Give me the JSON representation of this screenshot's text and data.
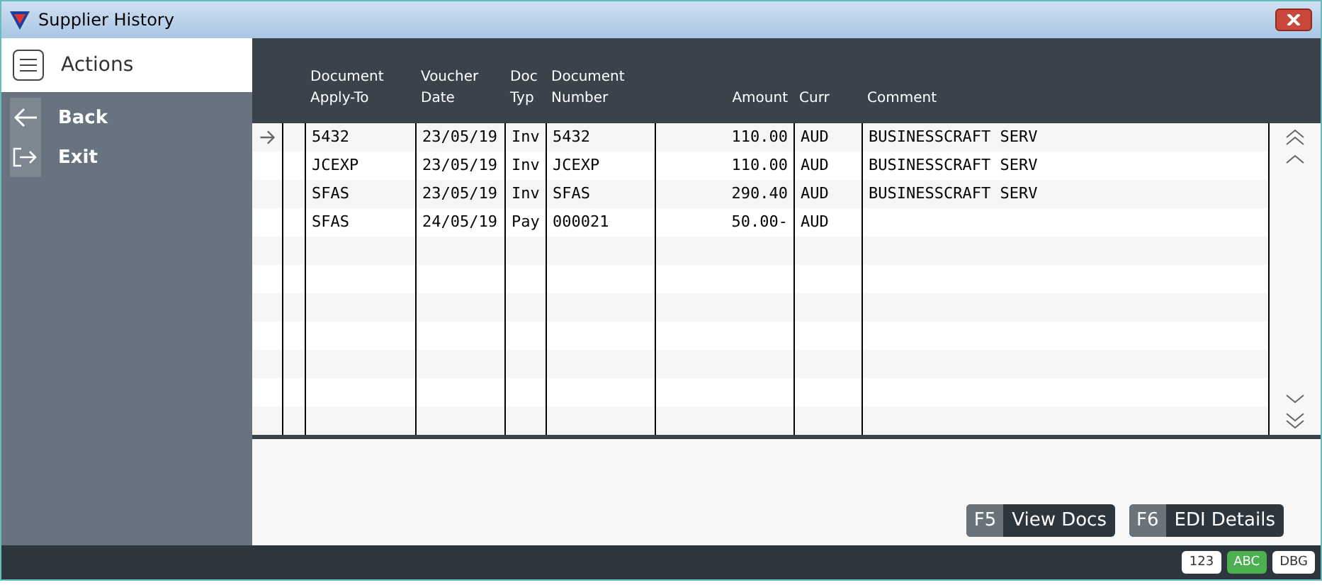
{
  "window": {
    "title": "Supplier History"
  },
  "sidebar": {
    "title": "Actions",
    "items": [
      {
        "label": "Back",
        "kind": "back"
      },
      {
        "label": "Exit",
        "kind": "exit"
      }
    ]
  },
  "table": {
    "columns": [
      {
        "label": "Document\nApply-To"
      },
      {
        "label": "Voucher\nDate"
      },
      {
        "label": "Doc\nTyp"
      },
      {
        "label": "Document\nNumber"
      },
      {
        "label": "Amount"
      },
      {
        "label": "Curr"
      },
      {
        "label": "Comment"
      }
    ],
    "rows": [
      {
        "selected": true,
        "cells": [
          "5432",
          "23/05/19",
          "Inv",
          "5432",
          "110.00",
          "AUD",
          "BUSINESSCRAFT SERV"
        ]
      },
      {
        "selected": false,
        "cells": [
          "JCEXP",
          "23/05/19",
          "Inv",
          "JCEXP",
          "110.00",
          "AUD",
          "BUSINESSCRAFT SERV"
        ]
      },
      {
        "selected": false,
        "cells": [
          "SFAS",
          "23/05/19",
          "Inv",
          "SFAS",
          "290.40",
          "AUD",
          "BUSINESSCRAFT SERV"
        ]
      },
      {
        "selected": false,
        "cells": [
          "SFAS",
          "24/05/19",
          "Pay",
          "000021",
          "50.00-",
          "AUD",
          ""
        ]
      }
    ]
  },
  "buttons": [
    {
      "key": "F5",
      "label": "View Docs"
    },
    {
      "key": "F6",
      "label": "EDI Details"
    }
  ],
  "status_bar": {
    "indicators": [
      {
        "label": "123",
        "on": false
      },
      {
        "label": "ABC",
        "on": true
      },
      {
        "label": "DBG",
        "on": false
      }
    ]
  }
}
